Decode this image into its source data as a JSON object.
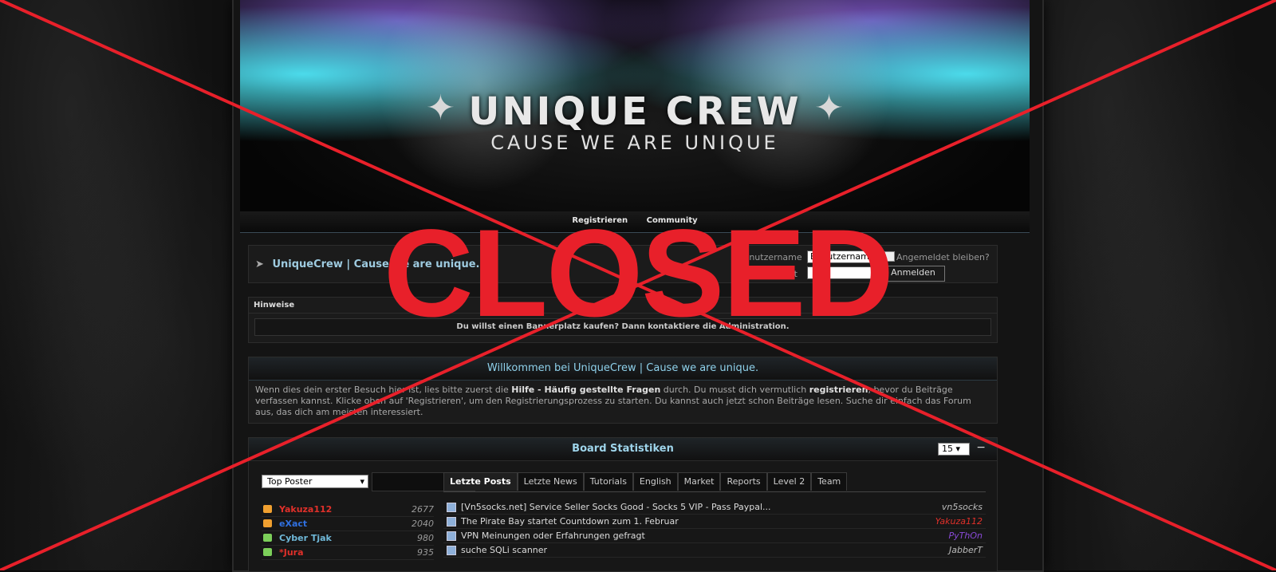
{
  "banner": {
    "logo_text": "UNIQUE CREW",
    "tagline": "CAUSE WE ARE UNIQUE"
  },
  "nav": {
    "register": "Registrieren",
    "community": "Community"
  },
  "breadcrumb": {
    "title": "UniqueCrew | Cause we are unique."
  },
  "login": {
    "username_label": "Benutzername",
    "username_value": "Benutzername",
    "password_label": "Kennwort",
    "remember_label": "Angemeldet bleiben?",
    "submit": "Anmelden"
  },
  "notices": {
    "heading": "Hinweise",
    "message": "Du willst einen Bannerplatz kaufen? Dann kontaktiere die Administration."
  },
  "welcome": {
    "title": "Willkommen bei UniqueCrew | Cause we are unique.",
    "p1": "Wenn dies dein erster Besuch hier ist, lies bitte zuerst die ",
    "faq_link": "Hilfe - Häufig gestellte Fragen",
    "p2": " durch. Du musst dich vermutlich ",
    "register_link": "registrieren",
    "p3": ", bevor du Beiträge verfassen kannst. Klicke oben auf 'Registrieren', um den Registrierungsprozess zu starten. Du kannst auch jetzt schon Beiträge lesen. Suche dir einfach das Forum aus, das dich am meisten interessiert."
  },
  "stats": {
    "title": "Board Statistiken",
    "limit": "15",
    "collapse": "−",
    "top_select": "Top Poster",
    "top_posters": [
      {
        "name": "Yakuza112",
        "count": "2677",
        "color": "#e0302a",
        "icon_color": "#f0a030"
      },
      {
        "name": "eXact",
        "count": "2040",
        "color": "#3070e0",
        "icon_color": "#f0a030"
      },
      {
        "name": "Cyber Tjak",
        "count": "980",
        "color": "#6fb8d8",
        "icon_color": "#7ccf5a"
      },
      {
        "name": "*Jura",
        "count": "935",
        "color": "#e0302a",
        "icon_color": "#7ccf5a"
      }
    ],
    "tabs": [
      "Letzte Posts",
      "Letzte News",
      "Tutorials",
      "English",
      "Market",
      "Reports",
      "Level 2",
      "Team"
    ],
    "posts": [
      {
        "title": "[Vn5socks.net] Service Seller Socks Good - Socks 5 VIP - Pass Paypal...",
        "author": "vn5socks",
        "author_color": "#bbbbbb"
      },
      {
        "title": "The Pirate Bay startet Countdown zum 1. Februar",
        "author": "Yakuza112",
        "author_color": "#e0302a"
      },
      {
        "title": "VPN Meinungen oder Erfahrungen gefragt",
        "author": "PyThOn",
        "author_color": "#8a4ad8"
      },
      {
        "title": "suche SQLi scanner",
        "author": "JabberT",
        "author_color": "#bbbbbb"
      }
    ]
  },
  "overlay": {
    "stamp": "CLOSED",
    "color": "#e8202a"
  }
}
